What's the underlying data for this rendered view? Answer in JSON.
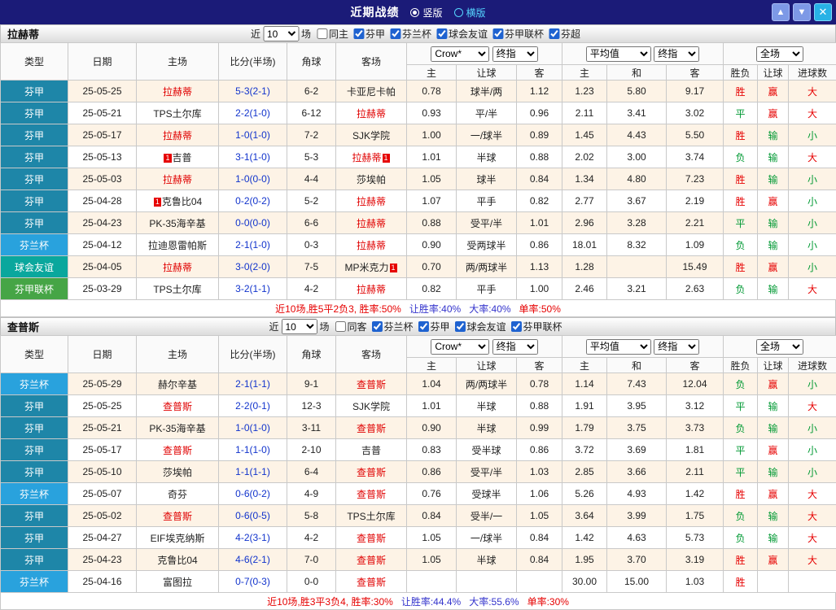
{
  "titlebar": {
    "title": "近期战绩",
    "vertical_label": "竖版",
    "horizontal_label": "横版",
    "up_icon": "▲",
    "down_icon": "▼",
    "close_icon": "✕"
  },
  "filter_labels": {
    "near": "近",
    "games": "场"
  },
  "table_header": {
    "type": "类型",
    "date": "日期",
    "home": "主场",
    "score": "比分(半场)",
    "corner": "角球",
    "away": "客场",
    "bookmaker": "Crow*",
    "final_odds": "终指",
    "average": "平均值",
    "final_odds2": "终指",
    "full_match": "全场",
    "sub_home": "主",
    "sub_handicap": "让球",
    "sub_away": "客",
    "sub_home2": "主",
    "sub_draw": "和",
    "sub_away2": "客",
    "sub_result": "胜负",
    "sub_handicap_result": "让球",
    "sub_goals": "进球数"
  },
  "type_colors": {
    "芬甲": "#1e86a8",
    "芬兰杯": "#29a2dd",
    "球会友谊": "#0aa79d",
    "芬甲联杯": "#46a546"
  },
  "sections": [
    {
      "team": "拉赫蒂",
      "filter": {
        "count": "10",
        "checkboxes": [
          {
            "label": "同主",
            "checked": false
          },
          {
            "label": "芬甲",
            "checked": true
          },
          {
            "label": "芬兰杯",
            "checked": true
          },
          {
            "label": "球会友谊",
            "checked": true
          },
          {
            "label": "芬甲联杯",
            "checked": true
          },
          {
            "label": "芬超",
            "checked": true
          }
        ]
      },
      "rows": [
        {
          "type": "芬甲",
          "date": "25-05-25",
          "home": "拉赫蒂",
          "home_red": true,
          "score": "5-3(2-1)",
          "corner": "6-2",
          "away": "卡亚尼卡帕",
          "asia_home": "0.78",
          "handicap": "球半/两",
          "asia_away": "1.12",
          "eu_home": "1.23",
          "eu_draw": "5.80",
          "eu_away": "9.17",
          "result": "胜",
          "handicap_result": "赢",
          "goals": "大"
        },
        {
          "type": "芬甲",
          "date": "25-05-21",
          "home": "TPS土尔库",
          "score": "2-2(1-0)",
          "corner": "6-12",
          "away": "拉赫蒂",
          "away_red": true,
          "asia_home": "0.93",
          "handicap": "平/半",
          "asia_away": "0.96",
          "eu_home": "2.11",
          "eu_draw": "3.41",
          "eu_away": "3.02",
          "result": "平",
          "handicap_result": "赢",
          "goals": "大"
        },
        {
          "type": "芬甲",
          "date": "25-05-17",
          "home": "拉赫蒂",
          "home_red": true,
          "score": "1-0(1-0)",
          "corner": "7-2",
          "away": "SJK学院",
          "asia_home": "1.00",
          "handicap": "一/球半",
          "asia_away": "0.89",
          "eu_home": "1.45",
          "eu_draw": "4.43",
          "eu_away": "5.50",
          "result": "胜",
          "handicap_result": "输",
          "goals": "小"
        },
        {
          "type": "芬甲",
          "date": "25-05-13",
          "home": "吉普",
          "home_pre_badge": "1",
          "score": "3-1(1-0)",
          "corner": "5-3",
          "away": "拉赫蒂",
          "away_red": true,
          "away_post_badge": "1",
          "asia_home": "1.01",
          "handicap": "半球",
          "asia_away": "0.88",
          "eu_home": "2.02",
          "eu_draw": "3.00",
          "eu_away": "3.74",
          "result": "负",
          "handicap_result": "输",
          "goals": "大"
        },
        {
          "type": "芬甲",
          "date": "25-05-03",
          "home": "拉赫蒂",
          "home_red": true,
          "score": "1-0(0-0)",
          "corner": "4-4",
          "away": "莎埃帕",
          "asia_home": "1.05",
          "handicap": "球半",
          "asia_away": "0.84",
          "eu_home": "1.34",
          "eu_draw": "4.80",
          "eu_away": "7.23",
          "result": "胜",
          "handicap_result": "输",
          "goals": "小"
        },
        {
          "type": "芬甲",
          "date": "25-04-28",
          "home": "克鲁比04",
          "home_pre_badge": "1",
          "score": "0-2(0-2)",
          "corner": "5-2",
          "away": "拉赫蒂",
          "away_red": true,
          "asia_home": "1.07",
          "handicap": "平手",
          "asia_away": "0.82",
          "eu_home": "2.77",
          "eu_draw": "3.67",
          "eu_away": "2.19",
          "result": "胜",
          "handicap_result": "赢",
          "goals": "小"
        },
        {
          "type": "芬甲",
          "date": "25-04-23",
          "home": "PK-35海辛基",
          "score": "0-0(0-0)",
          "corner": "6-6",
          "away": "拉赫蒂",
          "away_red": true,
          "asia_home": "0.88",
          "handicap": "受平/半",
          "asia_away": "1.01",
          "eu_home": "2.96",
          "eu_draw": "3.28",
          "eu_away": "2.21",
          "result": "平",
          "handicap_result": "输",
          "goals": "小"
        },
        {
          "type": "芬兰杯",
          "date": "25-04-12",
          "home": "拉迪恩雷帕斯",
          "score": "2-1(1-0)",
          "corner": "0-3",
          "away": "拉赫蒂",
          "away_red": true,
          "asia_home": "0.90",
          "handicap": "受两球半",
          "asia_away": "0.86",
          "eu_home": "18.01",
          "eu_draw": "8.32",
          "eu_away": "1.09",
          "result": "负",
          "handicap_result": "输",
          "goals": "小"
        },
        {
          "type": "球会友谊",
          "date": "25-04-05",
          "home": "拉赫蒂",
          "home_red": true,
          "score": "3-0(2-0)",
          "corner": "7-5",
          "away": "MP米克力",
          "away_post_badge": "1",
          "asia_home": "0.70",
          "handicap": "两/两球半",
          "asia_away": "1.13",
          "eu_home": "1.28",
          "eu_draw": "",
          "eu_away": "15.49",
          "result": "胜",
          "handicap_result": "赢",
          "goals": "小"
        },
        {
          "type": "芬甲联杯",
          "date": "25-03-29",
          "home": "TPS土尔库",
          "score": "3-2(1-1)",
          "corner": "4-2",
          "away": "拉赫蒂",
          "away_red": true,
          "asia_home": "0.82",
          "handicap": "平手",
          "asia_away": "1.00",
          "eu_home": "2.46",
          "eu_draw": "3.21",
          "eu_away": "2.63",
          "result": "负",
          "handicap_result": "输",
          "goals": "大"
        }
      ],
      "summary": [
        {
          "text": "近10场,胜5平2负3, 胜率:50%",
          "color": "#e60000"
        },
        {
          "text": "让胜率:40%",
          "color": "#3333cc"
        },
        {
          "text": "大率:40%",
          "color": "#3333cc"
        },
        {
          "text": "单率:50%",
          "color": "#e60000"
        }
      ]
    },
    {
      "team": "查普斯",
      "filter": {
        "count": "10",
        "checkboxes": [
          {
            "label": "同客",
            "checked": false
          },
          {
            "label": "芬兰杯",
            "checked": true
          },
          {
            "label": "芬甲",
            "checked": true
          },
          {
            "label": "球会友谊",
            "checked": true
          },
          {
            "label": "芬甲联杯",
            "checked": true
          }
        ]
      },
      "rows": [
        {
          "type": "芬兰杯",
          "date": "25-05-29",
          "home": "赫尔辛基",
          "score": "2-1(1-1)",
          "corner": "9-1",
          "away": "查普斯",
          "away_red": true,
          "asia_home": "1.04",
          "handicap": "两/两球半",
          "asia_away": "0.78",
          "eu_home": "1.14",
          "eu_draw": "7.43",
          "eu_away": "12.04",
          "result": "负",
          "handicap_result": "赢",
          "goals": "小"
        },
        {
          "type": "芬甲",
          "date": "25-05-25",
          "home": "查普斯",
          "home_red": true,
          "score": "2-2(0-1)",
          "corner": "12-3",
          "away": "SJK学院",
          "asia_home": "1.01",
          "handicap": "半球",
          "asia_away": "0.88",
          "eu_home": "1.91",
          "eu_draw": "3.95",
          "eu_away": "3.12",
          "result": "平",
          "handicap_result": "输",
          "goals": "大"
        },
        {
          "type": "芬甲",
          "date": "25-05-21",
          "home": "PK-35海辛基",
          "score": "1-0(1-0)",
          "corner": "3-11",
          "away": "查普斯",
          "away_red": true,
          "asia_home": "0.90",
          "handicap": "半球",
          "asia_away": "0.99",
          "eu_home": "1.79",
          "eu_draw": "3.75",
          "eu_away": "3.73",
          "result": "负",
          "handicap_result": "输",
          "goals": "小"
        },
        {
          "type": "芬甲",
          "date": "25-05-17",
          "home": "查普斯",
          "home_red": true,
          "score": "1-1(1-0)",
          "corner": "2-10",
          "away": "吉普",
          "asia_home": "0.83",
          "handicap": "受半球",
          "asia_away": "0.86",
          "eu_home": "3.72",
          "eu_draw": "3.69",
          "eu_away": "1.81",
          "result": "平",
          "handicap_result": "赢",
          "goals": "小"
        },
        {
          "type": "芬甲",
          "date": "25-05-10",
          "home": "莎埃帕",
          "score": "1-1(1-1)",
          "corner": "6-4",
          "away": "查普斯",
          "away_red": true,
          "asia_home": "0.86",
          "handicap": "受平/半",
          "asia_away": "1.03",
          "eu_home": "2.85",
          "eu_draw": "3.66",
          "eu_away": "2.11",
          "result": "平",
          "handicap_result": "输",
          "goals": "小"
        },
        {
          "type": "芬兰杯",
          "date": "25-05-07",
          "home": "奇芬",
          "score": "0-6(0-2)",
          "corner": "4-9",
          "away": "查普斯",
          "away_red": true,
          "asia_home": "0.76",
          "handicap": "受球半",
          "asia_away": "1.06",
          "eu_home": "5.26",
          "eu_draw": "4.93",
          "eu_away": "1.42",
          "result": "胜",
          "handicap_result": "赢",
          "goals": "大"
        },
        {
          "type": "芬甲",
          "date": "25-05-02",
          "home": "查普斯",
          "home_red": true,
          "score": "0-6(0-5)",
          "corner": "5-8",
          "away": "TPS土尔库",
          "asia_home": "0.84",
          "handicap": "受半/一",
          "asia_away": "1.05",
          "eu_home": "3.64",
          "eu_draw": "3.99",
          "eu_away": "1.75",
          "result": "负",
          "handicap_result": "输",
          "goals": "大"
        },
        {
          "type": "芬甲",
          "date": "25-04-27",
          "home": "EIF埃克纳斯",
          "score": "4-2(3-1)",
          "corner": "4-2",
          "away": "查普斯",
          "away_red": true,
          "asia_home": "1.05",
          "handicap": "一/球半",
          "asia_away": "0.84",
          "eu_home": "1.42",
          "eu_draw": "4.63",
          "eu_away": "5.73",
          "result": "负",
          "handicap_result": "输",
          "goals": "大"
        },
        {
          "type": "芬甲",
          "date": "25-04-23",
          "home": "克鲁比04",
          "score": "4-6(2-1)",
          "corner": "7-0",
          "away": "查普斯",
          "away_red": true,
          "asia_home": "1.05",
          "handicap": "半球",
          "asia_away": "0.84",
          "eu_home": "1.95",
          "eu_draw": "3.70",
          "eu_away": "3.19",
          "result": "胜",
          "handicap_result": "赢",
          "goals": "大"
        },
        {
          "type": "芬兰杯",
          "date": "25-04-16",
          "home": "富图拉",
          "score": "0-7(0-3)",
          "corner": "0-0",
          "away": "查普斯",
          "away_red": true,
          "asia_home": "",
          "handicap": "",
          "asia_away": "",
          "eu_home": "30.00",
          "eu_draw": "15.00",
          "eu_away": "1.03",
          "result": "胜",
          "handicap_result": "",
          "goals": ""
        }
      ],
      "summary": [
        {
          "text": "近10场,胜3平3负4, 胜率:30%",
          "color": "#e60000"
        },
        {
          "text": "让胜率:44.4%",
          "color": "#3333cc"
        },
        {
          "text": "大率:55.6%",
          "color": "#3333cc"
        },
        {
          "text": "单率:30%",
          "color": "#e60000"
        }
      ]
    }
  ]
}
